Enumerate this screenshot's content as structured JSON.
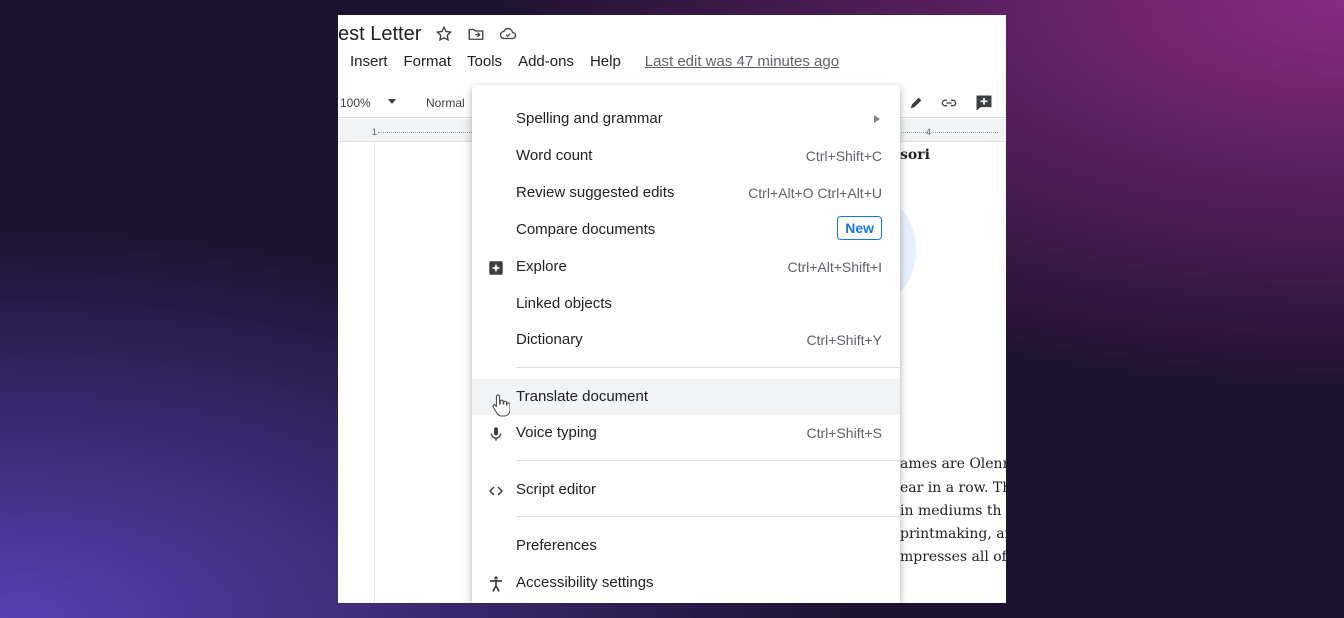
{
  "doc": {
    "title": "est Letter",
    "heading_fragment": "sori",
    "body_fragments": [
      "ames are Olenn",
      "ear in a row. Th",
      "in mediums th",
      "printmaking, ar",
      "mpresses all of"
    ]
  },
  "menubar": {
    "items": [
      "Insert",
      "Format",
      "Tools",
      "Add-ons",
      "Help"
    ],
    "last_edit": "Last edit was 47 minutes ago"
  },
  "toolbar": {
    "zoom": "100%",
    "style": "Normal"
  },
  "ruler": {
    "mark_1": "1",
    "mark_4": "4"
  },
  "tools_menu": {
    "items": [
      {
        "label": "Spelling and grammar",
        "shortcut": "",
        "submenu": true
      },
      {
        "label": "Word count",
        "shortcut": "Ctrl+Shift+C"
      },
      {
        "label": "Review suggested edits",
        "shortcut": "Ctrl+Alt+O Ctrl+Alt+U"
      },
      {
        "label": "Compare documents",
        "badge": "New"
      },
      {
        "label": "Explore",
        "shortcut": "Ctrl+Alt+Shift+I",
        "icon": "explore-icon"
      },
      {
        "label": "Linked objects",
        "shortcut": ""
      },
      {
        "label": "Dictionary",
        "shortcut": "Ctrl+Shift+Y"
      },
      {
        "label": "Translate document",
        "shortcut": "",
        "hovered": true
      },
      {
        "label": "Voice typing",
        "shortcut": "Ctrl+Shift+S",
        "icon": "microphone-icon"
      },
      {
        "label": "Script editor",
        "shortcut": "",
        "icon": "code-icon"
      },
      {
        "label": "Preferences",
        "shortcut": ""
      },
      {
        "label": "Accessibility settings",
        "shortcut": "",
        "icon": "accessibility-icon"
      }
    ]
  },
  "colors": {
    "accent": "#1a73e8",
    "hover": "#f1f3f4"
  }
}
